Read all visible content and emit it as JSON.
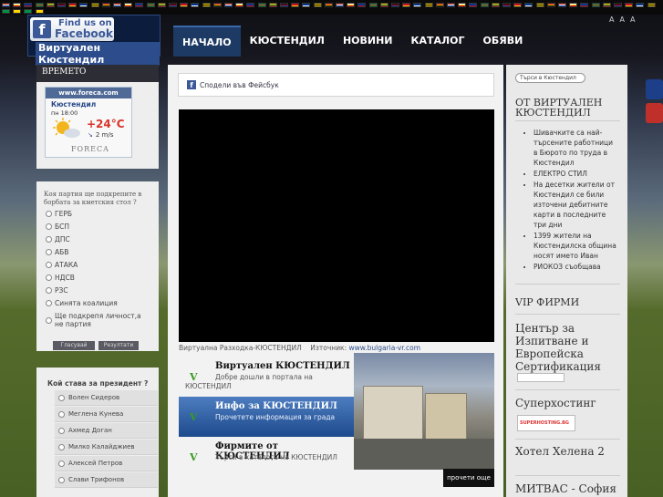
{
  "header": {
    "facebook_badge": {
      "line1": "Find us on",
      "line2": "Facebook",
      "site_name": "Виртуален Кюстендил"
    },
    "nav": [
      {
        "label": "НАЧАЛО",
        "active": true
      },
      {
        "label": "КЮСТЕНДИЛ",
        "active": false
      },
      {
        "label": "НОВИНИ",
        "active": false
      },
      {
        "label": "КАТАЛОГ",
        "active": false
      },
      {
        "label": "ОБЯВИ",
        "active": false
      }
    ],
    "font_size_controls": [
      "A",
      "A",
      "A"
    ]
  },
  "flags_bar": {
    "count": 59,
    "colors": [
      "#d52b1e",
      "#ffffff",
      "#0039a6",
      "#009246",
      "#ffce00",
      "#000000",
      "#c60c30",
      "#003580",
      "#ffd700",
      "#ce1126"
    ]
  },
  "weather": {
    "heading": "ВРЕМЕТО",
    "provider_url": "www.foreca.com",
    "city": "Кюстендил",
    "time": "пн 18:00",
    "temperature": "+24°C",
    "wind": "2 m/s",
    "provider_logo": "FORECA"
  },
  "poll": {
    "question": "Коя партия ще подкрепите в борбата за кметския стол ?",
    "options": [
      "ГЕРБ",
      "БСП",
      "ДПС",
      "АБВ",
      "АТАКА",
      "НДСВ",
      "РЗС",
      "Синята коалиция",
      "Ще подкрепя личност,а не партия"
    ],
    "vote_label": "Гласувай",
    "results_label": "Резултати"
  },
  "president_poll": {
    "question": "Кой става за президент ?",
    "options": [
      "Волен Сидеров",
      "Меглена Кунева",
      "Ахмед Доган",
      "Милко Калайджиев",
      "Алексей Петров",
      "Слави Трифонов"
    ]
  },
  "main": {
    "share_label": "Сподели във Фейсбук",
    "video_caption": "Виртуална Разходка-КЮСТЕНДИЛ",
    "video_source_label": "Източник:",
    "video_source_link": "www.bulgaria-vr.com",
    "promo": [
      {
        "title": "Виртуален КЮСТЕНДИЛ",
        "sub": "Добре дошли в портала на",
        "sub2": "КЮСТЕНДИЛ",
        "active": false
      },
      {
        "title": "Инфо за КЮСТЕНДИЛ",
        "sub": "Прочетете информация за града",
        "sub2": "",
        "active": true
      },
      {
        "title": "Фирмите от КЮСТЕНДИЛ",
        "sub": "Търси в каталога на КЮСТЕНДИЛ",
        "sub2": "",
        "active": false
      }
    ],
    "promo_logo": "V",
    "read_more": "прочети още"
  },
  "right": {
    "search_placeholder": "Търси в Кюстендил",
    "news_heading": "ОТ ВИРТУАЛЕН КЮСТЕНДИЛ",
    "news": [
      "Шивачките са най-търсените работници в Бюрото по труда в Кюстендил",
      "ЕЛЕКТРО СТИЛ",
      "На десетки жители от Кюстендил се били източени дебитните карти в последните три дни",
      "1399 жители на Кюстендилска община носят името Иван",
      "РИОКОЗ съобщава"
    ],
    "vip_heading": "VIP ФИРМИ",
    "companies": [
      "Център за Изпитване и Европейска Сертификация",
      "Суперхостинг",
      "Хотел Хелена 2",
      "МИТВАС - София"
    ],
    "superhosting_logo": "SUPERHOSTING.BG"
  }
}
